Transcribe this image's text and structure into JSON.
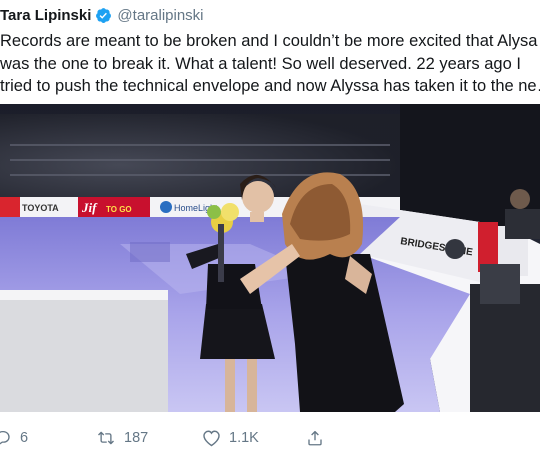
{
  "user": {
    "display_name": "Tara Lipinski",
    "handle": "@taralipinski",
    "verified": true
  },
  "tweet": {
    "lines": [
      "Records are meant to be broken and I couldn’t be more excited that Alysa",
      "was the one to break it. What a talent! So well deserved. 22 years ago I",
      "tried to push the technical envelope and now Alyssa has taken it to the ne…"
    ]
  },
  "media": {
    "description_icon": "photo",
    "signage": {
      "toyota": "TOYOTA",
      "jif": "Jif",
      "jif_to_go": "TO GO",
      "homelight": "HomeLight",
      "bridgestone": "BRIDGESTONE"
    }
  },
  "actions": {
    "reply_count": "6",
    "retweet_count": "187",
    "like_count": "1.1K"
  },
  "colors": {
    "verified": "#1da1f2",
    "muted": "#657786",
    "text": "#14171a"
  }
}
